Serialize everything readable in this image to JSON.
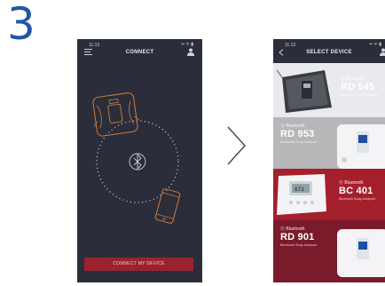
{
  "step_number": "3",
  "phone1": {
    "status_time": "11:13",
    "status_icons": "▪▪ ᯤ ▮",
    "title": "CONNECT",
    "connect_button": "CONNECT MY DEVICE"
  },
  "phone2": {
    "status_time": "11:13",
    "status_icons": "▪▪ ᯤ ▮",
    "title": "SELECT DEVICE",
    "devices": [
      {
        "brand": "ⓑ Bluetooth",
        "model": "RD 545",
        "desc": "Segmental Body Analyzer",
        "bg": "#e9eaed"
      },
      {
        "brand": "ⓑ Bluetooth",
        "model": "RD 953",
        "desc": "Bluetooth Body Analyzer",
        "bg": "#b7b6b8"
      },
      {
        "brand": "ⓑ Bluetooth",
        "model": "BC 401",
        "desc": "Bluetooth Body Analyzer",
        "bg": "#a41f2c"
      },
      {
        "brand": "ⓑ Bluetooth",
        "model": "RD 901",
        "desc": "Bluetooth Body Analyzer",
        "bg": "#7a1a2b"
      }
    ]
  },
  "colors": {
    "accent": "#9a2330",
    "step": "#1f57a5",
    "screen_bg": "#2b2e3a",
    "line_art": "#d07a3a"
  }
}
